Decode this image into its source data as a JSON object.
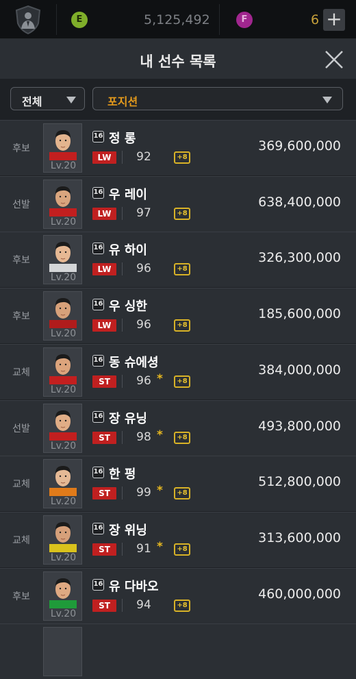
{
  "topbar": {
    "e_currency_icon": "E",
    "e_currency_value": "5,125,492",
    "f_currency_icon": "F",
    "f_currency_value": "6",
    "add_button_label": "+"
  },
  "header": {
    "title": "내 선수 목록",
    "close_icon": "close-icon"
  },
  "filters": {
    "all_label": "전체",
    "position_label": "포지션"
  },
  "level_prefix": "Lv.20",
  "season_badge": "16",
  "enhance_label": "+8",
  "players": [
    {
      "status": "후보",
      "name": "정 롱",
      "position": "LW",
      "ovr": "92",
      "star": false,
      "price": "369,600,000"
    },
    {
      "status": "선발",
      "name": "우 레이",
      "position": "LW",
      "ovr": "97",
      "star": false,
      "price": "638,400,000"
    },
    {
      "status": "후보",
      "name": "유 하이",
      "position": "LW",
      "ovr": "96",
      "star": false,
      "price": "326,300,000"
    },
    {
      "status": "후보",
      "name": "우 싱한",
      "position": "LW",
      "ovr": "96",
      "star": false,
      "price": "185,600,000"
    },
    {
      "status": "교체",
      "name": "동 슈에셩",
      "position": "ST",
      "ovr": "96",
      "star": true,
      "price": "384,000,000"
    },
    {
      "status": "선발",
      "name": "장 유닝",
      "position": "ST",
      "ovr": "98",
      "star": true,
      "price": "493,800,000"
    },
    {
      "status": "교체",
      "name": "한 펑",
      "position": "ST",
      "ovr": "99",
      "star": true,
      "price": "512,800,000"
    },
    {
      "status": "교체",
      "name": "장 위닝",
      "position": "ST",
      "ovr": "91",
      "star": true,
      "price": "313,600,000"
    },
    {
      "status": "후보",
      "name": "유 다바오",
      "position": "ST",
      "ovr": "94",
      "star": false,
      "price": "460,000,000"
    }
  ],
  "colors": {
    "accent_orange": "#e49a1c",
    "position_red": "#c02020",
    "enhance_gold": "#d8b227"
  }
}
